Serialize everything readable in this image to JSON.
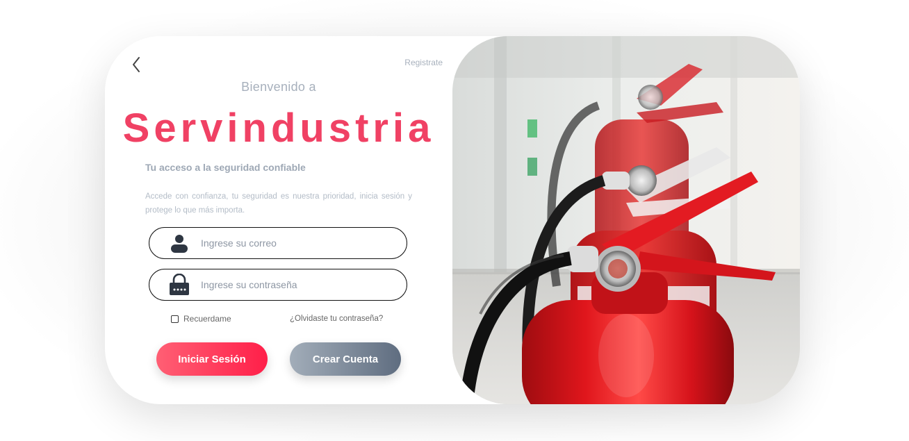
{
  "header": {
    "register_link": "Registrate"
  },
  "hero": {
    "welcome": "Bienvenido a",
    "brand": "Servindustria",
    "subtitle": "Tu acceso a la seguridad confiable",
    "description": "Accede con confianza, tu seguridad es nuestra prioridad, inicia sesión y protege lo que más importa."
  },
  "form": {
    "email_placeholder": "Ingrese su correo",
    "password_placeholder": "Ingrese su contraseña",
    "remember_label": "Recuerdame",
    "forgot_label": "¿Olvidaste tu contraseña?",
    "login_button": "Iniciar Sesión",
    "create_button": "Crear Cuenta"
  },
  "icons": {
    "back": "chevron-left-icon",
    "email": "user-icon",
    "password": "lock-icon"
  },
  "colors": {
    "brand": "#f04164",
    "login_gradient_start": "#ff5f74",
    "login_gradient_end": "#ff1f49",
    "create_gradient_start": "#a2adb9",
    "create_gradient_end": "#5f6d80",
    "muted_text": "#a7b0bc"
  }
}
